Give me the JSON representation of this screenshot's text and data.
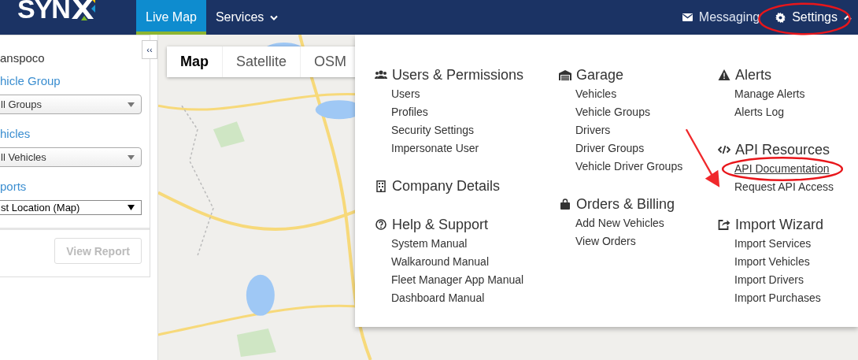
{
  "navbar": {
    "logo": "SYN",
    "tabs": [
      {
        "label": "Live Map",
        "selected": true,
        "kind": "plain"
      },
      {
        "label": "Services",
        "selected": false,
        "kind": "dropdown"
      }
    ],
    "right_items": [
      {
        "label": "Messaging",
        "kind": "messaging"
      },
      {
        "label": "Settings",
        "kind": "settings",
        "expanded": true
      }
    ]
  },
  "sidebar": {
    "collapse_button": "‹‹",
    "company": "anspoco",
    "fields": [
      {
        "label": "hicle Group",
        "value": "ll Groups",
        "kind": "combo"
      },
      {
        "label": "hicles",
        "value": "ll Vehicles",
        "kind": "combo"
      },
      {
        "label": "ports",
        "value": "st Location (Map)",
        "kind": "plain"
      }
    ],
    "view_button": {
      "label": "View Report",
      "disabled": true
    }
  },
  "map": {
    "kind": "picture",
    "type_tabs": [
      {
        "label": "Map",
        "selected": true
      },
      {
        "label": "Satellite",
        "selected": false
      },
      {
        "label": "OSM",
        "selected": false
      }
    ]
  },
  "settings_menu": {
    "columns": [
      [
        {
          "title": "Users & Permissions",
          "kind": "users",
          "items": [
            {
              "label": "Users",
              "hovered": false
            },
            {
              "label": "Profiles",
              "hovered": false
            },
            {
              "label": "Security Settings",
              "hovered": false
            },
            {
              "label": "Impersonate User",
              "hovered": false
            }
          ]
        },
        {
          "title": "Company Details",
          "kind": "building"
        },
        {
          "title": "Help & Support",
          "kind": "help",
          "items": [
            {
              "label": "System Manual",
              "hovered": false
            },
            {
              "label": "Walkaround Manual",
              "hovered": false
            },
            {
              "label": "Fleet Manager App Manual",
              "hovered": false
            },
            {
              "label": "Dashboard Manual",
              "hovered": false
            }
          ]
        }
      ],
      [
        {
          "title": "Garage",
          "kind": "garage",
          "items": [
            {
              "label": "Vehicles",
              "hovered": false
            },
            {
              "label": "Vehicle Groups",
              "hovered": false
            },
            {
              "label": "Drivers",
              "hovered": false
            },
            {
              "label": "Driver Groups",
              "hovered": false
            },
            {
              "label": "Vehicle Driver Groups",
              "hovered": false
            }
          ]
        },
        {
          "title": "Orders & Billing",
          "kind": "bag",
          "items": [
            {
              "label": "Add New Vehicles",
              "hovered": false
            },
            {
              "label": "View Orders",
              "hovered": false
            }
          ]
        }
      ],
      [
        {
          "title": "Alerts",
          "kind": "warning",
          "items": [
            {
              "label": "Manage Alerts",
              "hovered": false
            },
            {
              "label": "Alerts Log",
              "hovered": false
            }
          ]
        },
        {
          "title": "API Resources",
          "kind": "code",
          "items": [
            {
              "label": "API Documentation",
              "hovered": true
            },
            {
              "label": "Request API Access",
              "hovered": false
            }
          ]
        },
        {
          "title": "Import Wizard",
          "kind": "import",
          "items": [
            {
              "label": "Import Services",
              "hovered": false
            },
            {
              "label": "Import Vehicles",
              "hovered": false
            },
            {
              "label": "Import Drivers",
              "hovered": false
            },
            {
              "label": "Import Purchases",
              "hovered": false
            }
          ]
        }
      ]
    ]
  },
  "annotations": [
    {
      "kind": "ellipse"
    },
    {
      "kind": "arrow"
    },
    {
      "kind": "ellipse"
    }
  ]
}
